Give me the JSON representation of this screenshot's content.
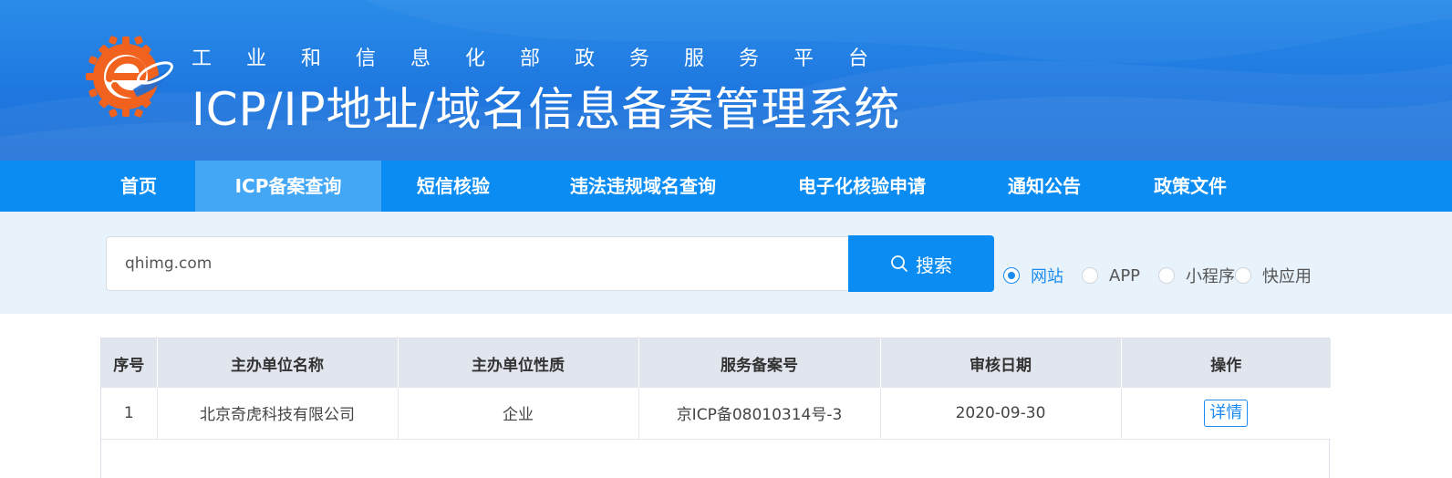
{
  "header": {
    "subtitle": "工业和信息化部政务服务平台",
    "title": "ICP/IP地址/域名信息备案管理系统",
    "logo_icon": "gear-e-logo-icon"
  },
  "nav": {
    "items": [
      {
        "label": "首页",
        "active": false
      },
      {
        "label": "ICP备案查询",
        "active": true
      },
      {
        "label": "短信核验",
        "active": false
      },
      {
        "label": "违法违规域名查询",
        "active": false
      },
      {
        "label": "电子化核验申请",
        "active": false
      },
      {
        "label": "通知公告",
        "active": false
      },
      {
        "label": "政策文件",
        "active": false
      }
    ]
  },
  "search": {
    "value": "qhimg.com",
    "button_label": "搜索",
    "button_icon": "search-icon",
    "options": [
      {
        "label": "网站",
        "checked": true
      },
      {
        "label": "APP",
        "checked": false
      },
      {
        "label": "小程序",
        "checked": false
      },
      {
        "label": "快应用",
        "checked": false
      }
    ]
  },
  "table": {
    "columns": [
      "序号",
      "主办单位名称",
      "主办单位性质",
      "服务备案号",
      "审核日期",
      "操作"
    ],
    "rows": [
      {
        "index": "1",
        "org_name": "北京奇虎科技有限公司",
        "org_type": "企业",
        "record_no": "京ICP备08010314号-3",
        "date": "2020-09-30",
        "action": "详情"
      }
    ]
  },
  "colors": {
    "header_blue": "#1f78e0",
    "nav_blue": "#0a8cf2",
    "nav_active": "#43a7f5",
    "search_band": "#e8f2fb",
    "table_header": "#e1e5ee",
    "link_blue": "#1a8cf0",
    "logo_orange": "#f0621e"
  }
}
